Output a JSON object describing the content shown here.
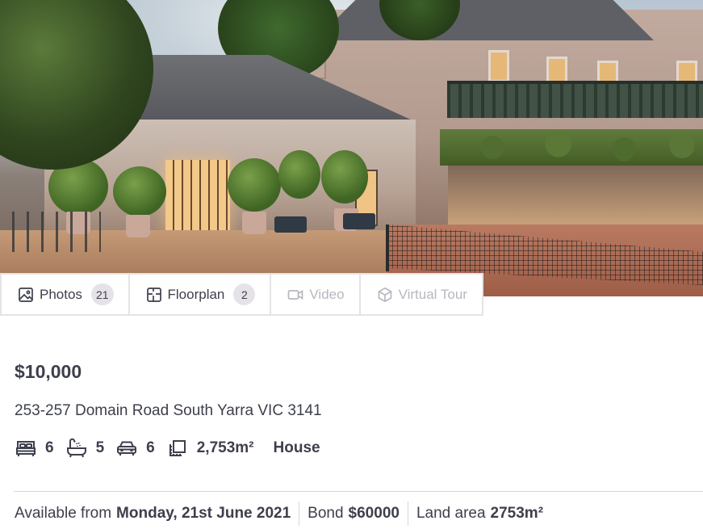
{
  "hero": {
    "alt_subject": "property-photo"
  },
  "media_tabs": [
    {
      "label": "Photos",
      "count": "21",
      "icon": "image-icon",
      "enabled": true
    },
    {
      "label": "Floorplan",
      "count": "2",
      "icon": "floorplan-icon",
      "enabled": true
    },
    {
      "label": "Video",
      "count": null,
      "icon": "video-icon",
      "enabled": false
    },
    {
      "label": "Virtual Tour",
      "count": null,
      "icon": "cube-icon",
      "enabled": false
    }
  ],
  "listing": {
    "price": "$10,000",
    "address": "253-257 Domain Road South Yarra VIC 3141",
    "features": {
      "bedrooms": "6",
      "bathrooms": "5",
      "parking": "6",
      "land_size": "2,753m²"
    },
    "property_type": "House"
  },
  "meta": {
    "available_label": "Available from",
    "available_value": "Monday, 21st June 2021",
    "bond_label": "Bond",
    "bond_value": "$60000",
    "land_label": "Land area",
    "land_value": "2753m²"
  },
  "colors": {
    "text": "#3d3f4c",
    "muted": "#b7b8bf",
    "border": "#e5e3e8"
  }
}
